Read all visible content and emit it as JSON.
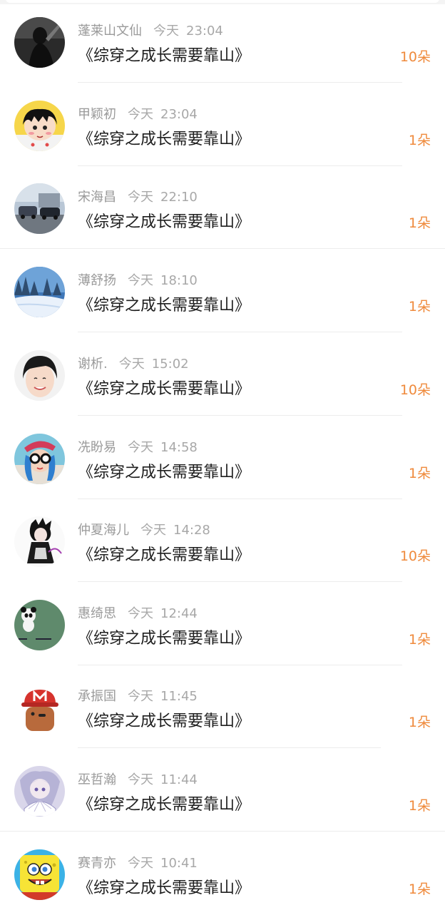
{
  "gifts": [
    {
      "name": "蓬莱山文仙",
      "day": "今天",
      "time": "23:04",
      "title": "《综穿之成长需要靠山》",
      "count": "10朵",
      "avatar": "silhouette-dark"
    },
    {
      "name": "甲颖初",
      "day": "今天",
      "time": "23:04",
      "title": "《综穿之成长需要靠山》",
      "count": "1朵",
      "avatar": "cartoon-girl"
    },
    {
      "name": "宋海昌",
      "day": "今天",
      "time": "22:10",
      "title": "《综穿之成长需要靠山》",
      "count": "1朵",
      "avatar": "cars-street"
    },
    {
      "name": "薄舒扬",
      "day": "今天",
      "time": "18:10",
      "title": "《综穿之成长需要靠山》",
      "count": "1朵",
      "avatar": "snowy-forest"
    },
    {
      "name": "谢析.",
      "day": "今天",
      "time": "15:02",
      "title": "《综穿之成长需要靠山》",
      "count": "10朵",
      "avatar": "smiling-boy"
    },
    {
      "name": "冼盼易",
      "day": "今天",
      "time": "14:58",
      "title": "《综穿之成长需要靠山》",
      "count": "1朵",
      "avatar": "girl-sunglasses"
    },
    {
      "name": "仲夏海儿",
      "day": "今天",
      "time": "14:28",
      "title": "《综穿之成长需要靠山》",
      "count": "10朵",
      "avatar": "anime-sketch"
    },
    {
      "name": "惠绮思",
      "day": "今天",
      "time": "12:44",
      "title": "《综穿之成长需要靠山》",
      "count": "1朵",
      "avatar": "panda-green"
    },
    {
      "name": "承振国",
      "day": "今天",
      "time": "11:45",
      "title": "《综穿之成长需要靠山》",
      "count": "1朵",
      "avatar": "red-cap-toy"
    },
    {
      "name": "巫哲瀚",
      "day": "今天",
      "time": "11:44",
      "title": "《综穿之成长需要靠山》",
      "count": "1朵",
      "avatar": "anime-fan-girl"
    },
    {
      "name": "赛青亦",
      "day": "今天",
      "time": "10:41",
      "title": "《综穿之成长需要靠山》",
      "count": "1朵",
      "avatar": "sponge-cartoon"
    }
  ]
}
